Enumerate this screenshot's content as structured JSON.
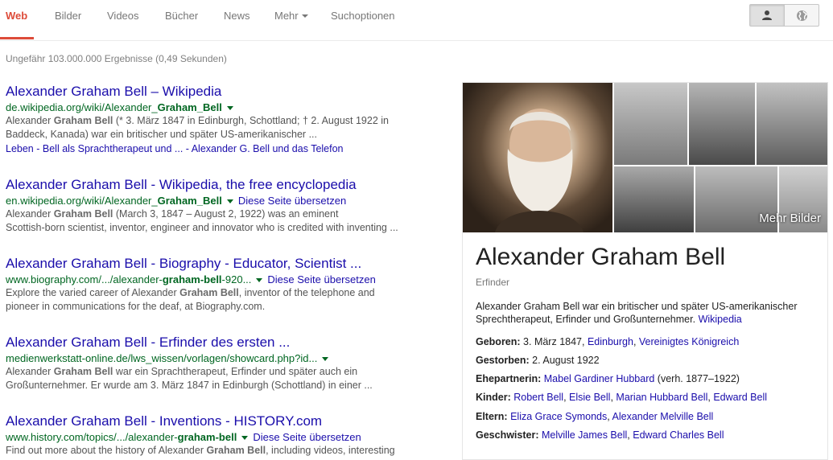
{
  "nav": {
    "tabs": [
      {
        "label": "Web",
        "active": true
      },
      {
        "label": "Bilder"
      },
      {
        "label": "Videos"
      },
      {
        "label": "Bücher"
      },
      {
        "label": "News"
      },
      {
        "label": "Mehr"
      },
      {
        "label": "Suchoptionen"
      }
    ],
    "toggle": {
      "left_icon": "person-icon",
      "right_icon": "globe-icon"
    }
  },
  "stats": "Ungefähr 103.000.000 Ergebnisse (0,49 Sekunden)",
  "results": [
    {
      "title": "Alexander Graham Bell – Wikipedia",
      "url_prefix": "de.wikipedia.org/wiki/Alexander_",
      "url_bold": "Graham_Bell",
      "url_suffix": "",
      "translate": "",
      "snippet1_pre": "Alexander ",
      "snippet1_bold": "Graham Bell",
      "snippet1_post": " (* 3. März 1847 in Edinburgh, Schottland; † 2. August 1922 in",
      "snippet2": "Baddeck, Kanada) war ein britischer und später US-amerikanischer ...",
      "link1": "Leben",
      "link2": "Bell als Sprachtherapeut und ...",
      "link3": "Alexander G. Bell und das Telefon"
    },
    {
      "title": "Alexander Graham Bell - Wikipedia, the free encyclopedia",
      "url_prefix": "en.wikipedia.org/wiki/Alexander_",
      "url_bold": "Graham_Bell",
      "url_suffix": "",
      "translate": "Diese Seite übersetzen",
      "snippet1_pre": "Alexander ",
      "snippet1_bold": "Graham Bell",
      "snippet1_post": " (March 3, 1847 – August 2, 1922) was an eminent",
      "snippet2": "Scottish-born scientist, inventor, engineer and innovator who is credited with inventing ..."
    },
    {
      "title": "Alexander Graham Bell - Biography - Educator, Scientist ...",
      "url_prefix": "www.biography.com/.../alexander-",
      "url_bold": "graham-bell",
      "url_suffix": "-920...",
      "translate": "Diese Seite übersetzen",
      "snippet1_pre": "Explore the varied career of Alexander ",
      "snippet1_bold": "Graham Bell",
      "snippet1_post": ", inventor of the telephone and",
      "snippet2": "pioneer in communications for the deaf, at Biography.com."
    },
    {
      "title": "Alexander Graham Bell - Erfinder des ersten ...",
      "url_prefix": "medienwerkstatt-online.de/lws_wissen/vorlagen/showcard.php?id...",
      "url_bold": "",
      "url_suffix": "",
      "translate": "",
      "snippet1_pre": "Alexander ",
      "snippet1_bold": "Graham Bell",
      "snippet1_post": " war ein Sprachtherapeut, Erfinder und später auch ein",
      "snippet2": "Großunternehmer. Er wurde am 3. März 1847 in Edinburgh (Schottland) in einer ..."
    },
    {
      "title": "Alexander Graham Bell - Inventions - HISTORY.com",
      "url_prefix": "www.history.com/topics/.../alexander-",
      "url_bold": "graham-bell",
      "url_suffix": "",
      "translate": "Diese Seite übersetzen",
      "snippet1_pre": "Find out more about the history of Alexander ",
      "snippet1_bold": "Graham Bell",
      "snippet1_post": ", including videos, interesting",
      "snippet2": ""
    }
  ],
  "panel": {
    "more_images": "Mehr Bilder",
    "title": "Alexander Graham Bell",
    "subtitle": "Erfinder",
    "description": "Alexander Graham Bell war ein britischer und später US-amerikanischer Sprechtherapeut, Erfinder und Großunternehmer.",
    "source": "Wikipedia",
    "facts": {
      "born_label": "Geboren:",
      "born_value": "3. März 1847, ",
      "born_link1": "Edinburgh",
      "born_link2": "Vereinigtes Königreich",
      "died_label": "Gestorben:",
      "died_value": "2. August 1922",
      "spouse_label": "Ehepartnerin:",
      "spouse_link": "Mabel Gardiner Hubbard",
      "spouse_value": " (verh. 1877–1922)",
      "children_label": "Kinder:",
      "children": [
        "Robert Bell",
        "Elsie Bell",
        "Marian Hubbard Bell",
        "Edward Bell"
      ],
      "parents_label": "Eltern:",
      "parents": [
        "Eliza Grace Symonds",
        "Alexander Melville Bell"
      ],
      "siblings_label": "Geschwister:",
      "siblings": [
        "Melville James Bell",
        "Edward Charles Bell"
      ]
    }
  }
}
